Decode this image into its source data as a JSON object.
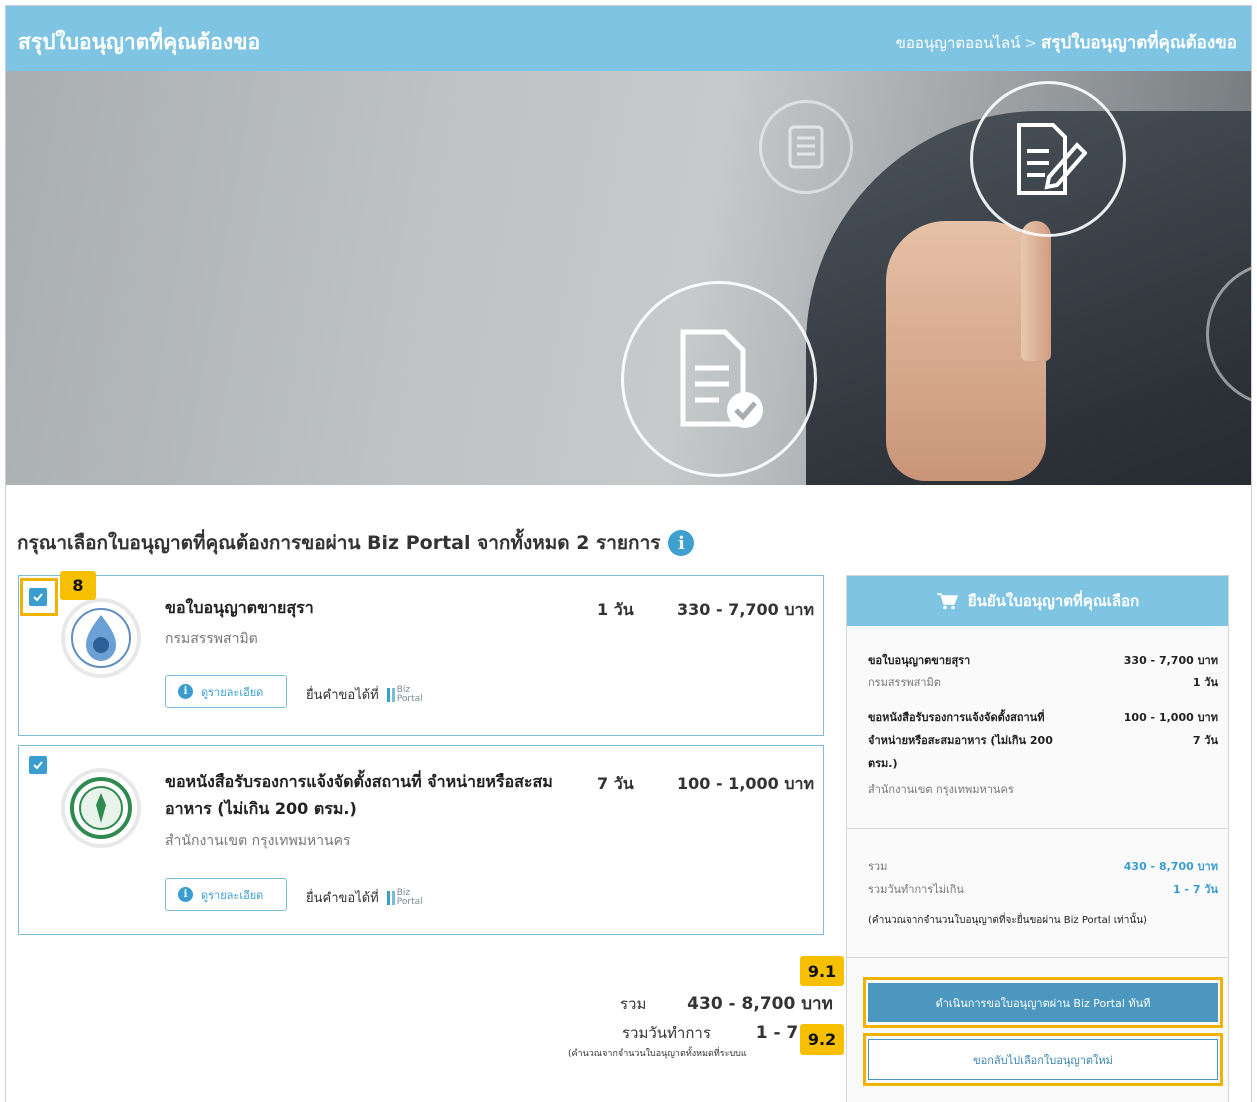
{
  "header": {
    "title": "สรุปใบอนุญาตที่คุณต้องขอ",
    "breadcrumb_parent": "ขออนุญาตออนไลน์",
    "breadcrumb_separator": ">",
    "breadcrumb_current": "สรุปใบอนุญาตที่คุณต้องขอ"
  },
  "section": {
    "title": "กรุณาเลือกใบอนุญาตที่คุณต้องการขอผ่าน Biz Portal จากทั้งหมด 2 รายการ",
    "info_glyph": "i"
  },
  "licenses": [
    {
      "checked": true,
      "title_line1": "ขอใบอนุญาตขายสุรา",
      "title_line2": "",
      "agency": "กรมสรรพสามิต",
      "days": "1 วัน",
      "fee": "330 - 7,700 บาท",
      "detail_label": "ดูรายละเอียด",
      "submit_label": "ยื่นคำขอได้ที่",
      "logo_icon": "excise-department-logo"
    },
    {
      "checked": true,
      "title_line1": "ขอหนังสือรับรองการแจ้งจัดตั้งสถานที่ จำหน่ายหรือสะสม",
      "title_line2": "อาหาร (ไม่เกิน 200 ตรม.)",
      "agency": "สำนักงานเขต กรุงเทพมหานคร",
      "days": "7 วัน",
      "fee": "100 - 1,000 บาท",
      "detail_label": "ดูรายละเอียด",
      "submit_label": "ยื่นคำขอได้ที่",
      "logo_icon": "bangkok-metropolitan-logo"
    }
  ],
  "biz_logo": {
    "line1": "Biz",
    "line2": "Portal"
  },
  "totals": {
    "sum_label": "รวม",
    "sum_value": "430 - 8,700 บาท",
    "days_label": "รวมวันทำการ",
    "days_value": "1 - 7",
    "note": "(คำนวณจากจำนวนใบอนุญาตทั้งหมดที่ระบบแ"
  },
  "summary": {
    "header": "ยืนยันใบอนุญาตที่คุณเลือก",
    "items": [
      {
        "title_line1": "ขอใบอนุญาตขายสุรา",
        "fee": "330 - 7,700 บาท",
        "agency": "กรมสรรพสามิต",
        "days": "1 วัน"
      },
      {
        "title_line1": "ขอหนังสือรับรองการแจ้งจัดตั้งสถานที่",
        "title_line2": "จำหน่ายหรือสะสมอาหาร (ไม่เกิน 200",
        "title_line3": "ตรม.)",
        "fee": "100 - 1,000 บาท",
        "days": "7 วัน",
        "agency": "สำนักงานเขต กรุงเทพมหานคร"
      }
    ],
    "sum_label": "รวม",
    "sum_value": "430 - 8,700 บาท",
    "days_label": "รวมวันทำการไม่เกิน",
    "days_value": "1 - 7 วัน",
    "note": "(คำนวณจากจำนวนใบอนุญาตที่จะยื่นขอผ่าน Biz Portal เท่านั้น)",
    "primary_button": "ดำเนินการขอใบอนุญาตผ่าน Biz Portal ทันที",
    "secondary_button": "ขอกลับไปเลือกใบอนุญาตใหม่"
  },
  "annotations": {
    "marker_8": "8",
    "marker_9_1": "9.1",
    "marker_9_2": "9.2",
    "highlight_color": "#f0b400"
  },
  "colors": {
    "accent": "#7fc4e3",
    "button": "#4b97bf",
    "link": "#3a9dd0"
  }
}
